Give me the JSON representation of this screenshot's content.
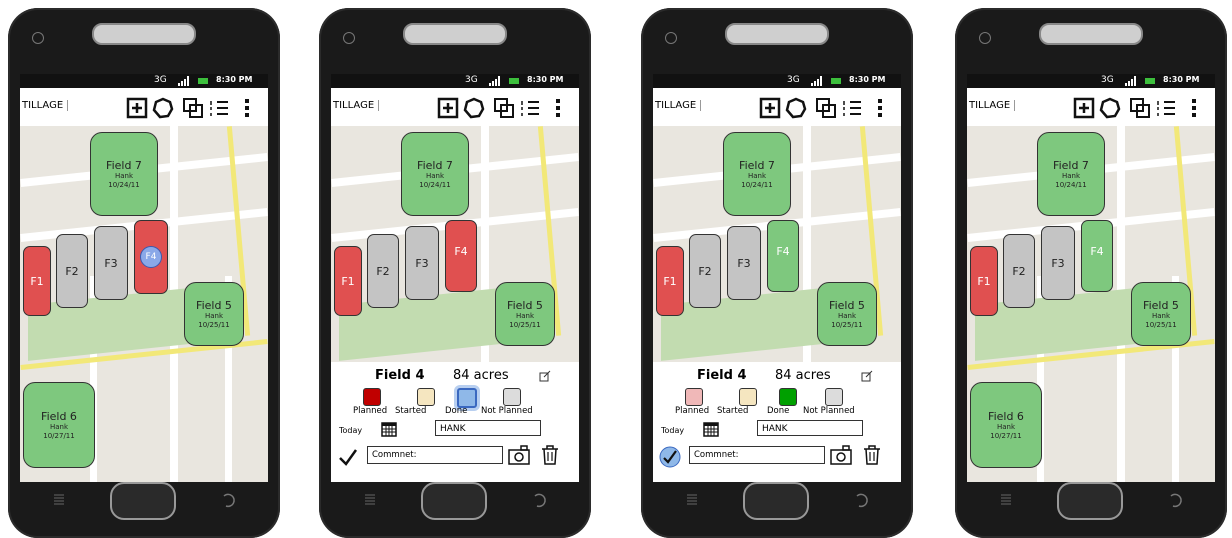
{
  "status_bar": {
    "network": "3G",
    "time": "8:30 PM"
  },
  "toolbar": {
    "title": "TILLAGE"
  },
  "fields": {
    "f7": {
      "name": "Field 7",
      "owner": "Hank",
      "date": "10/24/11"
    },
    "f5": {
      "name": "Field 5",
      "owner": "Hank",
      "date": "10/25/11"
    },
    "f6": {
      "name": "Field 6",
      "owner": "Hank",
      "date": "10/27/11"
    },
    "f1": "F1",
    "f2": "F2",
    "f3": "F3",
    "f4": "F4"
  },
  "panel": {
    "field_name": "Field 4",
    "acres": "84 acres",
    "status_labels": [
      "Planned",
      "Started",
      "Done",
      "Not Planned"
    ],
    "today_label": "Today",
    "owner_value": "HANK",
    "comment_placeholder": "Commnet:"
  },
  "colors": {
    "green": "#7ec87e",
    "red": "#e05050",
    "gray": "#c4c4c4",
    "planned": "#c00000",
    "planned_light": "#f0b8b8",
    "started": "#f5e6c0",
    "done": "#8fb8e8",
    "done_selected": "#00a000",
    "not_planned": "#dcdcdc"
  }
}
